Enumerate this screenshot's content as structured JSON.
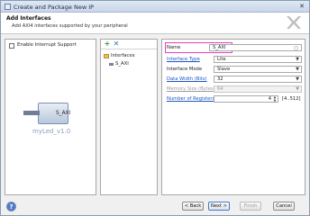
{
  "window": {
    "title": "Create and Package New IP",
    "close_glyph": "✕"
  },
  "header": {
    "title": "Add Interfaces",
    "subtitle": "Add AXI4 interfaces supported by your peripheral"
  },
  "left_panel": {
    "interrupt_label": "Enable Interrupt Support",
    "interrupt_checked": false,
    "ip_port_label": "S_AXI",
    "ip_name": "myLed_v1.0"
  },
  "mid_panel": {
    "add_glyph": "+",
    "delete_glyph": "✕",
    "folder_label": "Interfaces",
    "item_label": "S_AXI"
  },
  "properties": {
    "name": {
      "label": "Name",
      "value": "S_AXI"
    },
    "interface_type": {
      "label": "Interface Type",
      "value": "Lite"
    },
    "interface_mode": {
      "label": "Interface Mode",
      "value": "Slave"
    },
    "data_width": {
      "label": "Data Width (Bits)",
      "value": "32"
    },
    "memory_size": {
      "label": "Memory Size (Bytes)",
      "value": "64"
    },
    "num_registers": {
      "label": "Number of Registers",
      "value": "4",
      "range": "[4..512]"
    },
    "dropdown_arrow": "▼",
    "spin_up": "▲",
    "spin_down": "▼"
  },
  "footer": {
    "help_label": "?",
    "back_label": "< Back",
    "next_label": "Next >",
    "finish_label": "Finish",
    "cancel_label": "Cancel"
  },
  "colors": {
    "highlight": "#e23fbf",
    "link": "#1a56c4"
  }
}
